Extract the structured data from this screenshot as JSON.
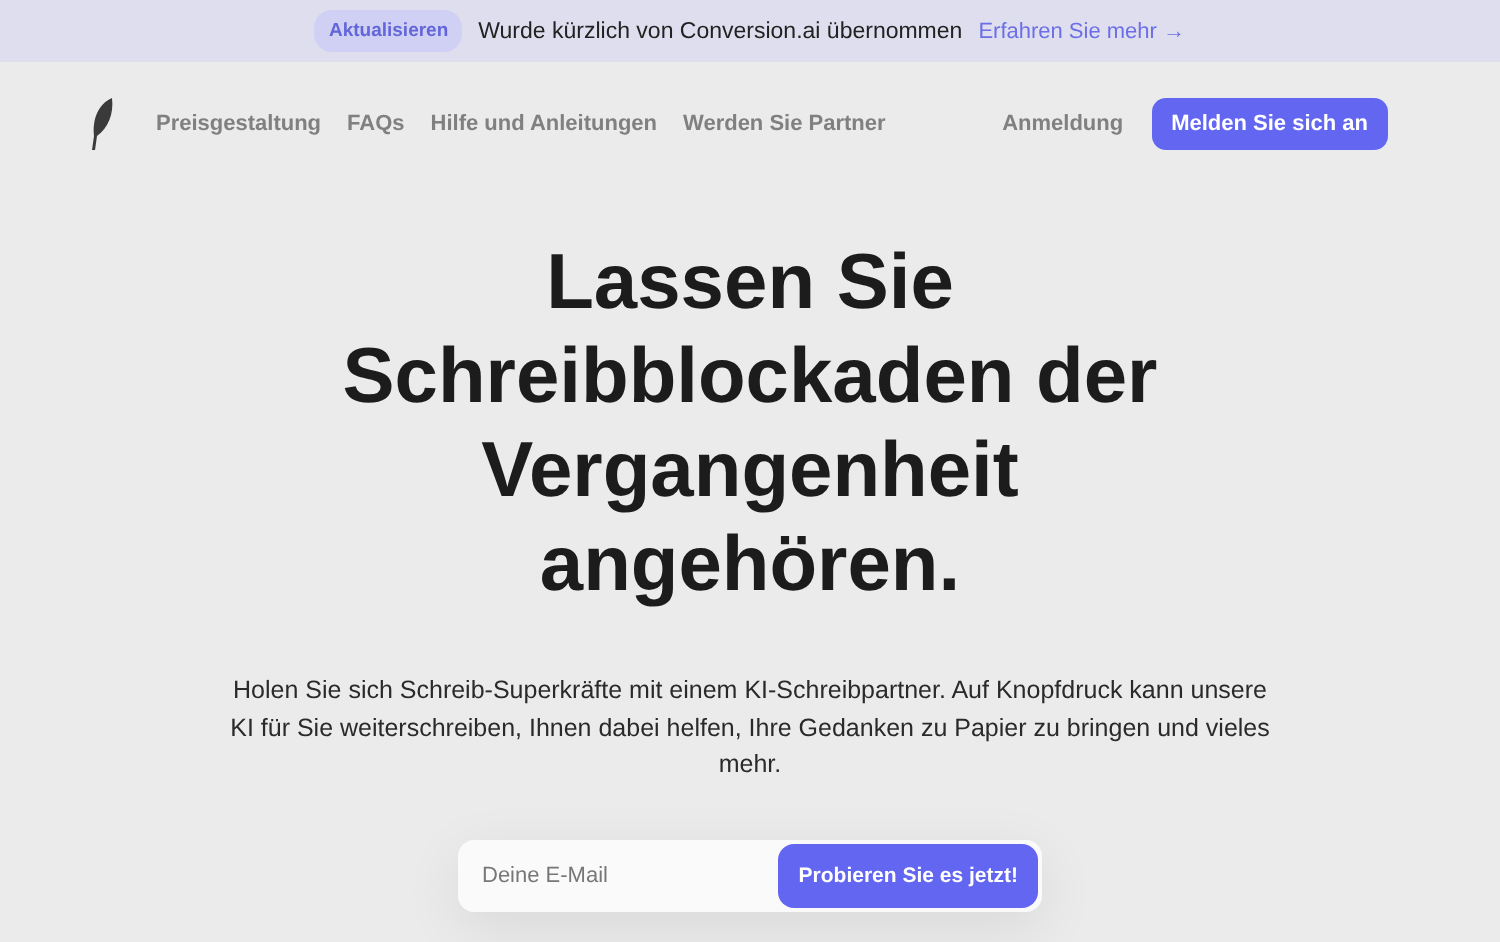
{
  "announcement": {
    "badge": "Aktualisieren",
    "message": "Wurde kürzlich von Conversion.ai übernommen",
    "link": "Erfahren Sie mehr →"
  },
  "nav": {
    "links": [
      "Preisgestaltung",
      "FAQs",
      "Hilfe und Anleitungen",
      "Werden Sie Partner"
    ],
    "login": "Anmeldung",
    "signup": "Melden Sie sich an"
  },
  "hero": {
    "headline": "Lassen Sie Schreibblockaden der Vergangenheit angehören.",
    "description": "Holen Sie sich Schreib-Superkräfte mit einem KI-Schreibpartner. Auf Knopfdruck kann unsere KI für Sie weiterschreiben, Ihnen dabei helfen, Ihre Gedanken zu Papier zu bringen und vieles mehr.",
    "email": {
      "placeholder": "Deine E-Mail"
    },
    "cta": "Probieren Sie es jetzt!"
  }
}
